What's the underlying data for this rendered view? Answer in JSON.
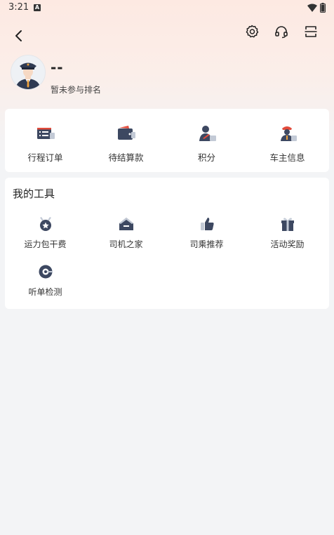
{
  "status_bar": {
    "time": "3:21",
    "notification_badge": "A"
  },
  "header": {
    "back_icon": "chevron-left-icon",
    "settings_icon": "gear-icon",
    "support_icon": "headset-icon",
    "scan_icon": "scan-icon"
  },
  "profile": {
    "name": "--",
    "rank_text": "暂未参与排名"
  },
  "quick_actions": [
    {
      "label": "行程订单",
      "icon": "order-list-icon"
    },
    {
      "label": "待结算款",
      "icon": "wallet-icon"
    },
    {
      "label": "积分",
      "icon": "points-user-icon"
    },
    {
      "label": "车主信息",
      "icon": "driver-info-icon"
    }
  ],
  "tools": {
    "title": "我的工具",
    "items": [
      {
        "label": "运力包干费",
        "icon": "medal-icon"
      },
      {
        "label": "司机之家",
        "icon": "home-icon"
      },
      {
        "label": "司乘推荐",
        "icon": "thumbs-up-icon"
      },
      {
        "label": "活动奖励",
        "icon": "gift-icon"
      },
      {
        "label": "听单检测",
        "icon": "listen-check-icon"
      }
    ]
  },
  "colors": {
    "icon_dark": "#3d4861",
    "icon_light": "#c3cad6",
    "accent_red": "#e24b3b",
    "accent_orange": "#f0a23a"
  }
}
